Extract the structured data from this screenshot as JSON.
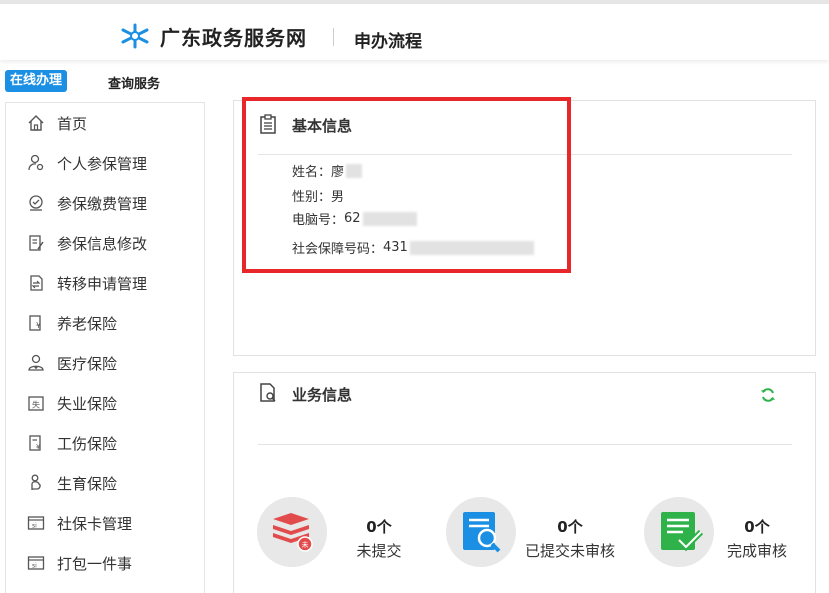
{
  "header": {
    "site_title": "广东政务服务网",
    "subtitle": "申办流程",
    "logo_icon": "snowflake-logo-icon",
    "brand_color": "#1a8fe3"
  },
  "tabs": [
    {
      "label": "在线办理",
      "active": true
    },
    {
      "label": "查询服务",
      "active": false
    }
  ],
  "sidebar": {
    "items": [
      {
        "label": "首页",
        "icon": "home-icon"
      },
      {
        "label": "个人参保管理",
        "icon": "person-gear-icon"
      },
      {
        "label": "参保缴费管理",
        "icon": "payment-icon"
      },
      {
        "label": "参保信息修改",
        "icon": "edit-document-icon"
      },
      {
        "label": "转移申请管理",
        "icon": "transfer-icon"
      },
      {
        "label": "养老保险",
        "icon": "pension-icon"
      },
      {
        "label": "医疗保险",
        "icon": "medical-person-icon"
      },
      {
        "label": "失业保险",
        "icon": "unemployment-icon"
      },
      {
        "label": "工伤保险",
        "icon": "injury-icon"
      },
      {
        "label": "生育保险",
        "icon": "maternity-icon"
      },
      {
        "label": "社保卡管理",
        "icon": "si-card-icon"
      },
      {
        "label": "打包一件事",
        "icon": "si-package-icon"
      }
    ]
  },
  "basic_info": {
    "title": "基本信息",
    "name_label": "姓名：",
    "name_value": "廖",
    "gender_label": "性别：",
    "gender_value": "男",
    "pc_label": "电脑号：",
    "pc_value": "62",
    "ssn_label": "社会保障号码：",
    "ssn_value": "431"
  },
  "biz_info": {
    "title": "业务信息",
    "refresh_icon": "refresh-icon",
    "stats": [
      {
        "count": "0个",
        "label": "未提交",
        "icon": "stack-unsubmitted-icon",
        "color": "#e24b4b"
      },
      {
        "count": "0个",
        "label": "已提交未审核",
        "icon": "document-search-icon",
        "color": "#1a8fe3"
      },
      {
        "count": "0个",
        "label": "完成审核",
        "icon": "document-check-icon",
        "color": "#2fb24a"
      }
    ]
  },
  "highlight_color": "#e8272b"
}
